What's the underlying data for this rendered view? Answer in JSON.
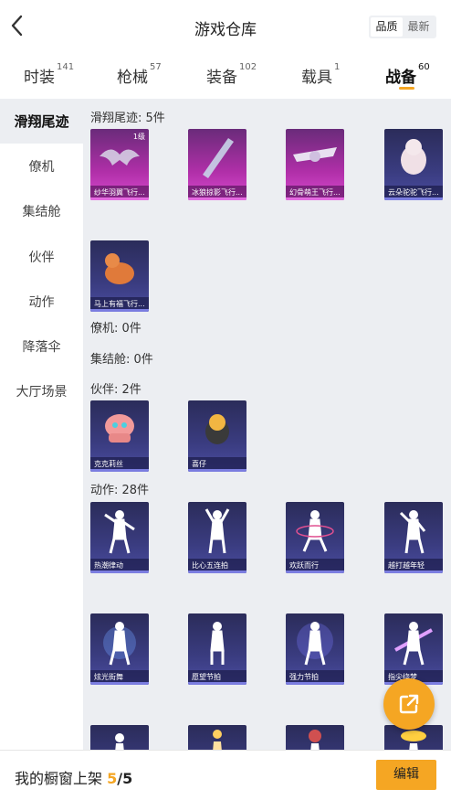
{
  "header": {
    "title": "游戏仓库",
    "sort_options": [
      "品质",
      "最新"
    ]
  },
  "tabs": [
    {
      "label": "时装",
      "count": "141"
    },
    {
      "label": "枪械",
      "count": "57"
    },
    {
      "label": "装备",
      "count": "102"
    },
    {
      "label": "载具",
      "count": "1"
    },
    {
      "label": "战备",
      "count": "60"
    }
  ],
  "sidenav": [
    "滑翔尾迹",
    "僚机",
    "集结舱",
    "伙伴",
    "动作",
    "降落伞",
    "大厅场景"
  ],
  "sections": {
    "trail": {
      "title": "滑翔尾迹: 5件",
      "items": [
        {
          "name": "纱华羽翼飞行...",
          "level": "1级"
        },
        {
          "name": "冰狼掠影飞行..."
        },
        {
          "name": "幻骨萌王飞行..."
        },
        {
          "name": "云朵驼驼飞行..."
        },
        {
          "name": "马上有福飞行..."
        }
      ]
    },
    "wingman": {
      "title": "僚机: 0件"
    },
    "capsule": {
      "title": "集结舱: 0件"
    },
    "partner": {
      "title": "伙伴: 2件",
      "items": [
        {
          "name": "克克莉丝"
        },
        {
          "name": "喜仔"
        }
      ]
    },
    "emote": {
      "title": "动作: 28件",
      "items": [
        {
          "name": "热潮律动"
        },
        {
          "name": "比心五连拍"
        },
        {
          "name": "欢跃而行"
        },
        {
          "name": "越打越年轻"
        },
        {
          "name": "炫光街舞"
        },
        {
          "name": "愿望节拍"
        },
        {
          "name": "强力节拍"
        },
        {
          "name": "指尖绕梦"
        }
      ]
    }
  },
  "bottom": {
    "label": "我的橱窗上架",
    "current": "5",
    "total": "/5",
    "edit": "编辑"
  },
  "colors": {
    "accent": "#f5a623"
  }
}
